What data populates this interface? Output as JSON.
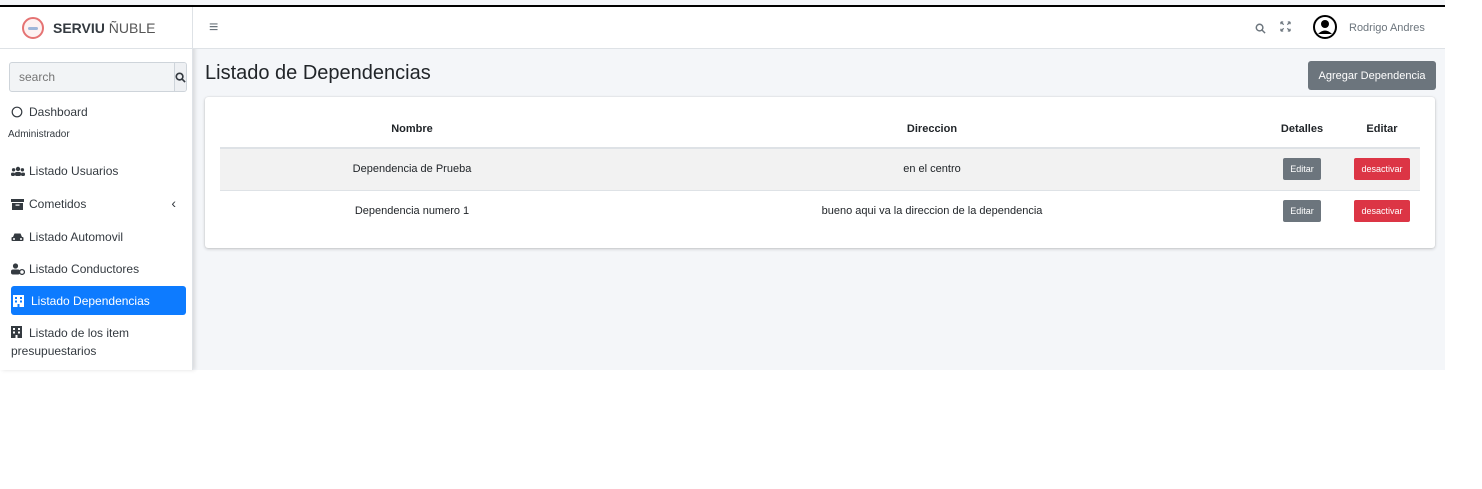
{
  "brand": {
    "name_bold": "SERVIU",
    "name_light": " ÑUBLE"
  },
  "sidebar": {
    "search_placeholder": "search",
    "items": [
      {
        "label": "Dashboard",
        "icon": "circle-icon"
      },
      {
        "label": "Listado Usuarios",
        "icon": "users-icon"
      },
      {
        "label": "Cometidos",
        "icon": "archive-icon"
      },
      {
        "label": "Listado Automovil",
        "icon": "car-icon"
      },
      {
        "label": "Listado Conductores",
        "icon": "user-driver-icon"
      },
      {
        "label": "Listado Dependencias",
        "icon": "building-icon"
      },
      {
        "label": "Listado de los item",
        "label2": "presupuestarios",
        "icon": "building-icon"
      }
    ],
    "header": "Administrador"
  },
  "topbar": {
    "user_name": "Rodrigo Andres"
  },
  "page": {
    "title": "Listado de Dependencias",
    "add_button": "Agregar Dependencia"
  },
  "table": {
    "headers": [
      "Nombre",
      "Direccion",
      "Detalles",
      "Editar"
    ],
    "rows": [
      {
        "nombre": "Dependencia de Prueba",
        "direccion": "en el centro",
        "edit": "Editar",
        "toggle": "desactivar"
      },
      {
        "nombre": "Dependencia numero 1",
        "direccion": "bueno aqui va la direccion de la dependencia",
        "edit": "Editar",
        "toggle": "desactivar"
      }
    ]
  },
  "colors": {
    "primary": "#0d7bff",
    "secondary": "#6c757d",
    "danger": "#dc3545"
  }
}
